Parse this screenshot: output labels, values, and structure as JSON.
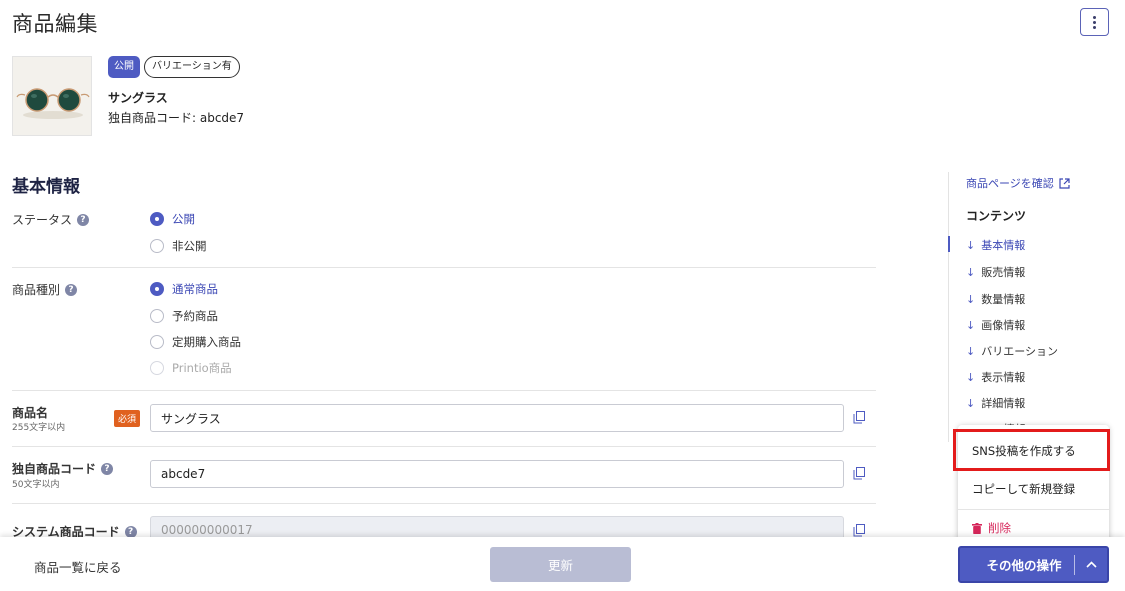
{
  "header": {
    "title": "商品編集"
  },
  "product": {
    "badge_public": "公開",
    "badge_variation": "バリエーション有",
    "name": "サングラス",
    "code_line": "独自商品コード: abcde7"
  },
  "basic": {
    "section_title": "基本情報",
    "status": {
      "label": "ステータス",
      "options": [
        "公開",
        "非公開"
      ],
      "selected": "公開"
    },
    "type": {
      "label": "商品種別",
      "options": [
        "通常商品",
        "予約商品",
        "定期購入商品",
        "Printio商品"
      ],
      "selected": "通常商品"
    },
    "product_name": {
      "label": "商品名",
      "hint": "255文字以内",
      "required": "必須",
      "value": "サングラス"
    },
    "own_code": {
      "label": "独自商品コード",
      "hint": "50文字以内",
      "value": "abcde7"
    },
    "system_code": {
      "label": "システム商品コード",
      "value": "000000000017"
    }
  },
  "sidebar": {
    "page_link": "商品ページを確認",
    "heading": "コンテンツ",
    "items": [
      {
        "label": "基本情報"
      },
      {
        "label": "販売情報"
      },
      {
        "label": "数量情報"
      },
      {
        "label": "画像情報"
      },
      {
        "label": "バリエーション"
      },
      {
        "label": "表示情報"
      },
      {
        "label": "詳細情報"
      },
      {
        "label": "SEO情報"
      }
    ]
  },
  "dropdown": {
    "items": [
      "SNS投稿を作成する",
      "コピーして新規登録",
      "削除"
    ]
  },
  "footer": {
    "back": "商品一覧に戻る",
    "update": "更新",
    "other": "その他の操作"
  },
  "colors": {
    "accent": "#4e5bc2",
    "required": "#e0611f",
    "danger": "#d6265a",
    "highlight": "#e31b1b"
  }
}
